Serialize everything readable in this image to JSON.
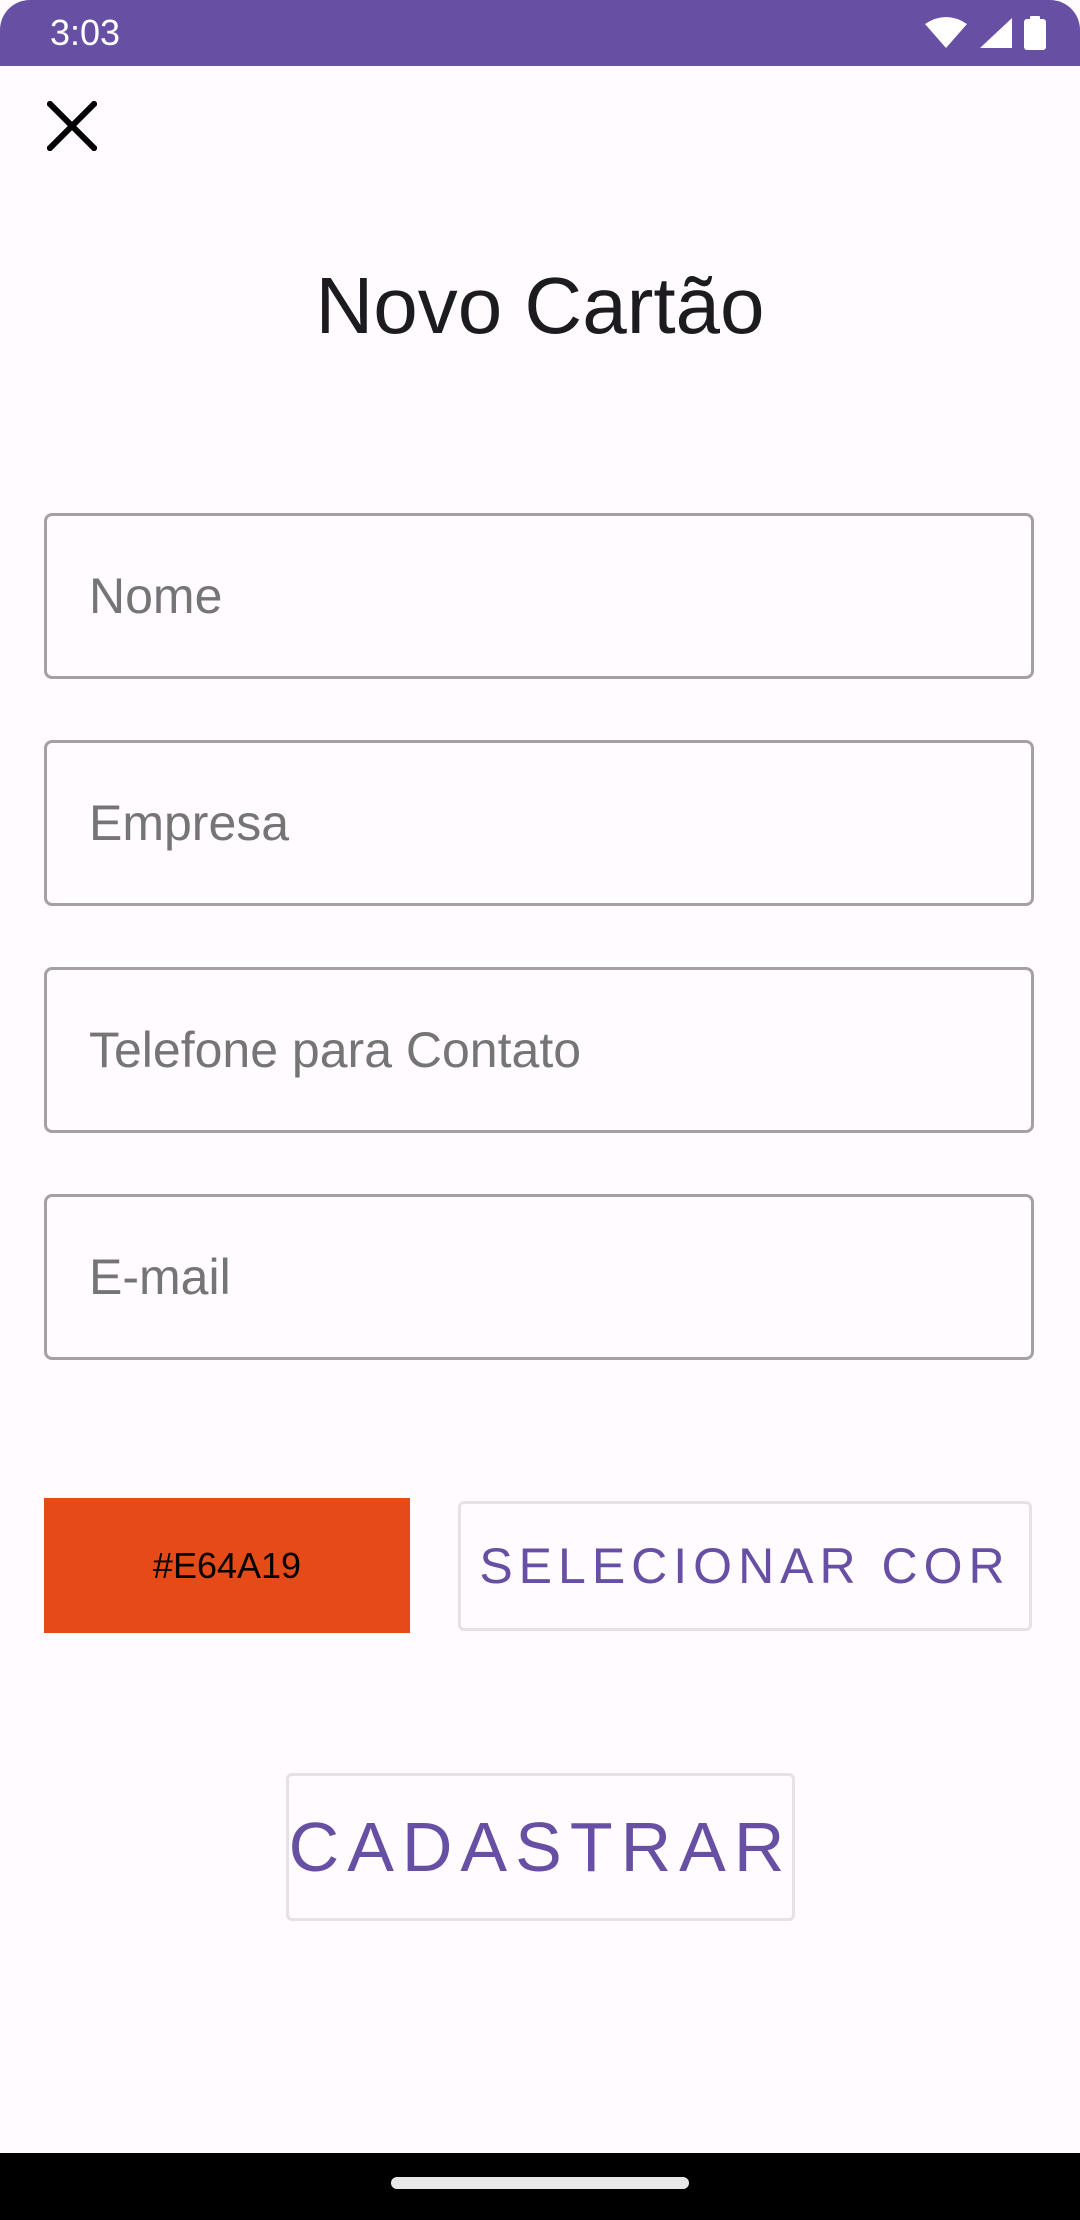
{
  "status_bar": {
    "time": "3:03",
    "icons": [
      "wifi-icon",
      "signal-icon",
      "battery-icon"
    ],
    "background_color": "#6750A4"
  },
  "toolbar": {
    "close_icon": "close-icon"
  },
  "title": "Novo Cartão",
  "form": {
    "name": {
      "placeholder": "Nome",
      "value": ""
    },
    "company": {
      "placeholder": "Empresa",
      "value": ""
    },
    "phone": {
      "placeholder": "Telefone para Contato",
      "value": ""
    },
    "email": {
      "placeholder": "E-mail",
      "value": ""
    }
  },
  "color_picker": {
    "selected_color": "#E64A19",
    "select_button_label": "SELECIONAR COR"
  },
  "submit_button_label": "CADASTRAR",
  "theme": {
    "accent": "#6750A4",
    "background": "#FFFBFE"
  }
}
